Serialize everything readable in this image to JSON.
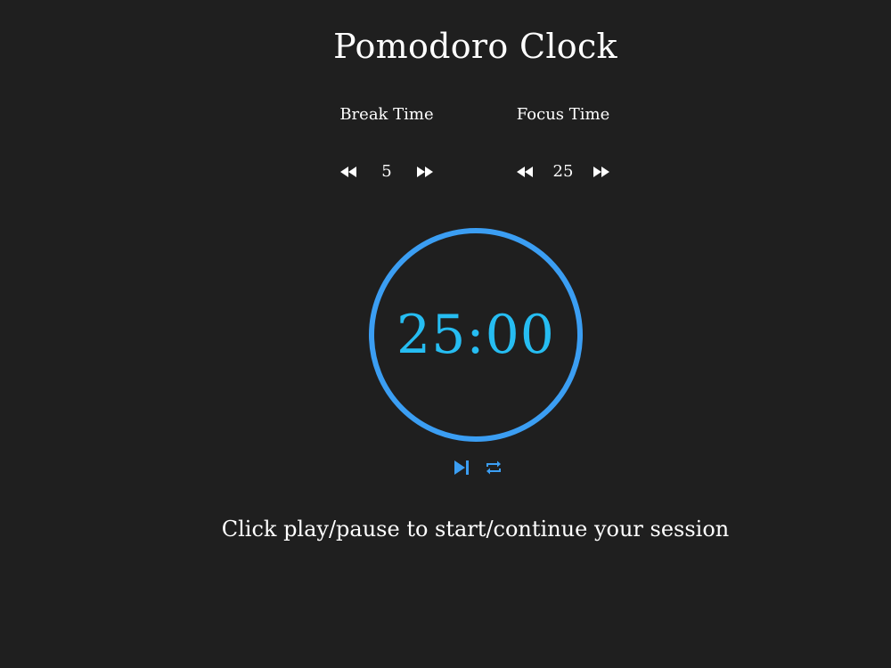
{
  "app": {
    "title": "Pomodoro Clock"
  },
  "break": {
    "label": "Break Time",
    "value": "5"
  },
  "focus": {
    "label": "Focus Time",
    "value": "25"
  },
  "timer": {
    "display": "25:00"
  },
  "player": {
    "play_pause_icon": "skip-forward-icon",
    "reset_icon": "repeat-icon"
  },
  "message": "Click play/pause to start/continue your session",
  "colors": {
    "background": "#1f1f1f",
    "accent": "#3b9ef3",
    "timer_text": "#26bdf2",
    "text": "#ffffff"
  }
}
